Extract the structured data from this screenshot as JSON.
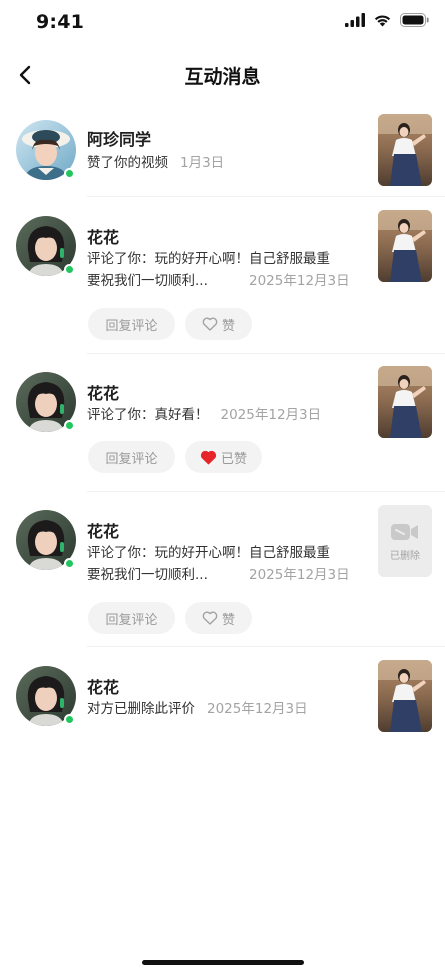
{
  "status_bar": {
    "time": "9:41"
  },
  "nav": {
    "title": "互动消息"
  },
  "messages": [
    {
      "name": "阿珍同学",
      "content": "赞了你的视频",
      "time": "1月3日",
      "thumbnail": "video-thumbnail"
    },
    {
      "name": "花花",
      "content": "评论了你：玩的好开心啊！自己舒服最重要祝我们一切顺利...",
      "content_line1": "评论了你：玩的好开心啊！自己舒服最重",
      "content_line2": "要祝我们一切顺利...",
      "time": "2025年12月3日",
      "reply_label": "回复评论",
      "like_label": "赞",
      "liked": false
    },
    {
      "name": "花花",
      "content": "评论了你：真好看！",
      "time": "2025年12月3日",
      "reply_label": "回复评论",
      "like_label": "已赞",
      "liked": true
    },
    {
      "name": "花花",
      "content_line1": "评论了你：玩的好开心啊！自己舒服最重",
      "content_line2": "要祝我们一切顺利...",
      "time": "2025年12月3日",
      "reply_label": "回复评论",
      "like_label": "赞",
      "liked": false,
      "deleted_label": "已删除"
    },
    {
      "name": "花花",
      "content": "对方已删除此评价",
      "time": "2025年12月3日"
    }
  ],
  "colors": {
    "online": "#22c55e",
    "liked_heart": "#e5252a",
    "muted": "#a3a3a3"
  }
}
